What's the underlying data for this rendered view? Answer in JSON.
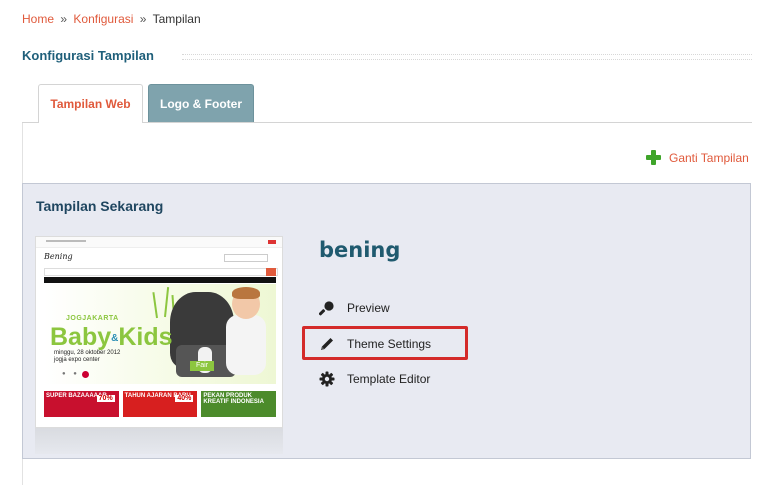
{
  "breadcrumb": {
    "home": "Home",
    "sep1": "»",
    "konfigurasi": "Konfigurasi",
    "sep2": "»",
    "current": "Tampilan"
  },
  "page_title": "Konfigurasi Tampilan",
  "tabs": [
    {
      "label": "Tampilan Web",
      "active": true
    },
    {
      "label": "Logo & Footer",
      "active": false
    }
  ],
  "ganti_tampilan": {
    "label": "Ganti Tampilan",
    "icon": "plus-icon"
  },
  "panel": {
    "title": "Tampilan Sekarang",
    "theme_name": "bening",
    "actions": [
      {
        "label": "Preview",
        "icon": "magnifier-icon"
      },
      {
        "label": "Theme Settings",
        "icon": "pencil-icon",
        "highlighted": true
      },
      {
        "label": "Template Editor",
        "icon": "gear-icon"
      }
    ]
  },
  "thumbnail": {
    "logo": "Bening",
    "banner_top": "JOGJAKARTA",
    "banner_main": "Baby",
    "banner_amp": "&",
    "banner_main2": "Kids",
    "banner_date": "minggu, 28 oktober 2012",
    "banner_venue": "jogja expo center",
    "banner_fair": "Fair",
    "ad1_label": "SUPER BAZAAAAAR",
    "ad1_tag": "70%",
    "ad2_label": "TAHUN AJARAN BARU",
    "ad2_tag": "40%",
    "ad3_label": "PEKAN PRODUK KREATIF INDONESIA"
  },
  "colors": {
    "link": "#e05a3c",
    "title": "#1f5f7a",
    "panel_bg": "#e8eaf2",
    "tab_inactive_bg": "#7fa3ad",
    "highlight": "#d42a2a",
    "plus": "#3fa52a"
  }
}
